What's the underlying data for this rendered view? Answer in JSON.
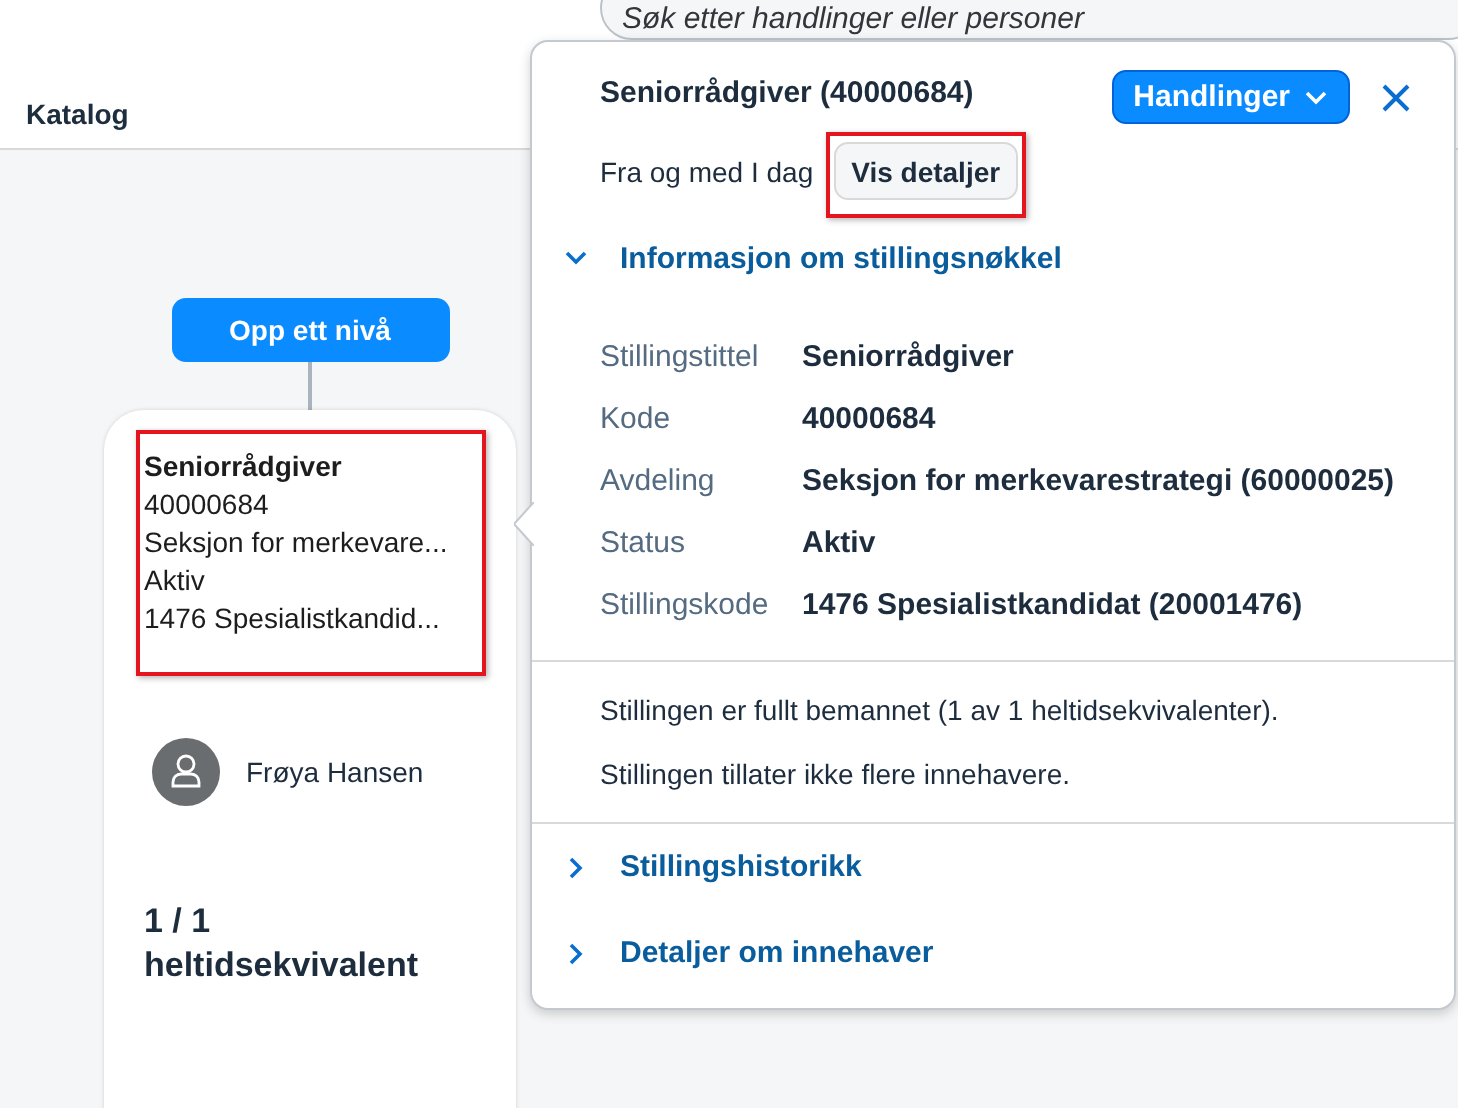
{
  "header": {
    "title": "Katalog"
  },
  "search": {
    "placeholder": "Søk etter handlinger eller personer"
  },
  "chart": {
    "up_button": "Opp ett nivå",
    "node": {
      "lines": [
        {
          "text": "Seniorrådgiver",
          "kind": "title"
        },
        {
          "text": "40000684",
          "kind": "plain"
        },
        {
          "text": "Seksjon for merkevare...",
          "kind": "plain"
        },
        {
          "text": "Aktiv",
          "kind": "plain"
        },
        {
          "text": "1476 Spesialistkandid...",
          "kind": "plain"
        }
      ],
      "holder": "Frøya Hansen",
      "fte": "1 / 1",
      "fte_label": "heltidsekvivalent"
    }
  },
  "popover": {
    "title": "Seniorrådgiver (40000684)",
    "actions_button": "Handlinger",
    "from_label": "Fra og med I dag",
    "details_button": "Vis detaljer",
    "sections": [
      {
        "title": "Informasjon om stillingsnøkkel",
        "expanded": true,
        "fields": [
          {
            "label": "Stillingstittel",
            "value": "Seniorrådgiver"
          },
          {
            "label": "Kode",
            "value": "40000684"
          },
          {
            "label": "Avdeling",
            "value": "Seksjon for merkevarestrategi (60000025)"
          },
          {
            "label": "Status",
            "value": "Aktiv"
          },
          {
            "label": "Stillingskode",
            "value": "1476 Spesialistkandidat (20001476)"
          }
        ],
        "notes": [
          "Stillingen er fullt bemannet (1 av 1 heltidsekvivalenter).",
          "Stillingen tillater ikke flere innehavere."
        ]
      },
      {
        "title": "Stillingshistorikk",
        "expanded": false
      },
      {
        "title": "Detaljer om innehaver",
        "expanded": false
      }
    ]
  }
}
